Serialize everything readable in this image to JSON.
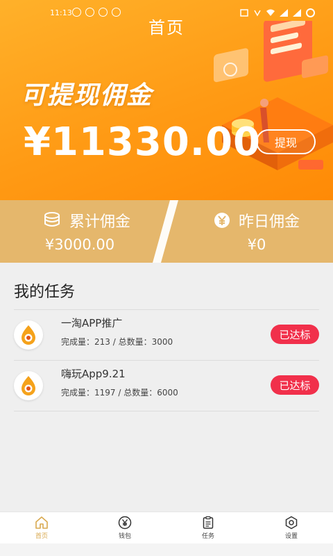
{
  "status_bar": {
    "time": "11:13"
  },
  "header": {
    "title": "首页"
  },
  "hero": {
    "label": "可提现佣金",
    "amount": "¥11330.00",
    "withdraw_label": "提现"
  },
  "stats": {
    "total": {
      "label": "累计佣金",
      "value": "¥3000.00"
    },
    "yesterday": {
      "label": "昨日佣金",
      "value": "¥0"
    }
  },
  "tasks": {
    "title": "我的任务",
    "items": [
      {
        "name": "一淘APP推广",
        "meta": "完成量：213 / 总数量：3000",
        "badge": "已达标"
      },
      {
        "name": "嗨玩App9.21",
        "meta": "完成量：1197 / 总数量：6000",
        "badge": "已达标"
      }
    ]
  },
  "tabbar": {
    "items": [
      {
        "label": "首页",
        "icon": "home-icon"
      },
      {
        "label": "钱包",
        "icon": "wallet-icon"
      },
      {
        "label": "任务",
        "icon": "task-icon"
      },
      {
        "label": "设置",
        "icon": "settings-icon"
      }
    ]
  },
  "colors": {
    "hero_start": "#ffb12a",
    "hero_end": "#ff8a06",
    "stats_band": "#e5b76c",
    "badge": "#f1304b",
    "tab_active": "#d9a94f"
  }
}
